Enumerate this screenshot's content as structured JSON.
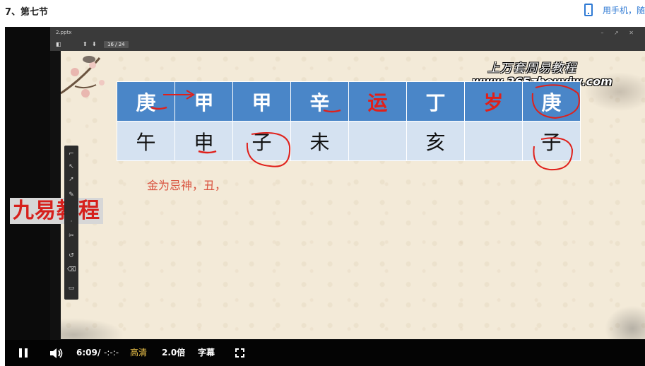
{
  "header": {
    "lesson_title": "7、第七节",
    "phone_link": "用手机，随"
  },
  "app": {
    "filename": "2.pptx",
    "page_indicator": "16 / 24"
  },
  "slide": {
    "watermark_title": "上万套周易教程",
    "watermark_url": "www.265zhouyiw.com",
    "top_row": [
      "庚",
      "甲",
      "甲",
      "辛",
      "运",
      "丁",
      "岁",
      "庚"
    ],
    "bottom_row": [
      "午",
      "申",
      "子",
      "未",
      "",
      "亥",
      "",
      "子"
    ],
    "note": "金为忌神，丑，",
    "logo": "九易教程"
  },
  "player": {
    "current_time": "6:09",
    "separator": "/",
    "duration": "-:-:-",
    "quality": "高清",
    "speed": "2.0倍",
    "subtitle": "字幕"
  },
  "colors": {
    "link_blue": "#2f7ad4",
    "table_header": "#4a86c8",
    "table_body": "#d5e2f1",
    "red_annotation": "#e0201a",
    "gold_text": "#f1c64b"
  }
}
